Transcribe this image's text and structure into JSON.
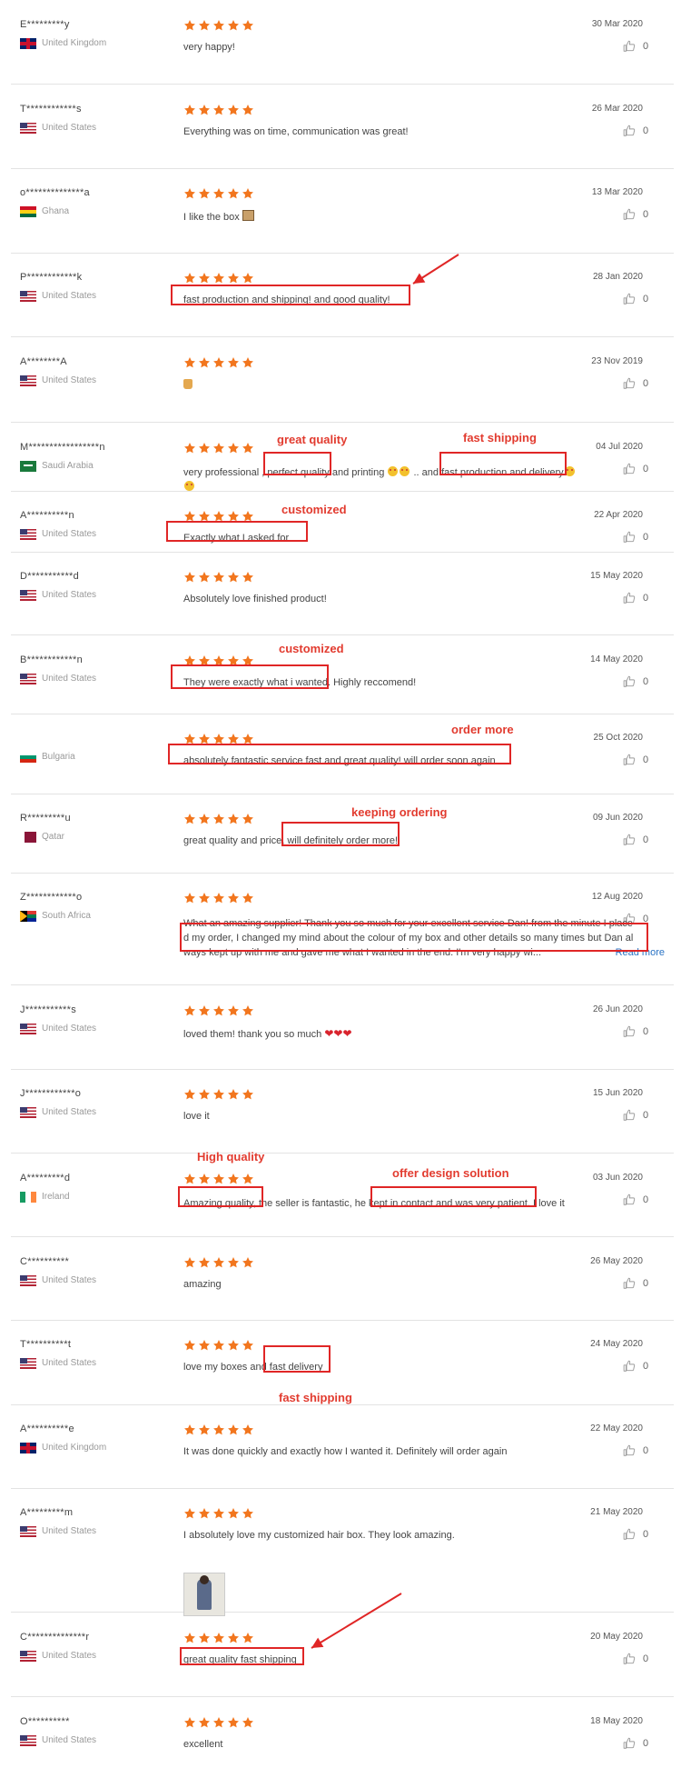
{
  "colors": {
    "star": "#f2761e",
    "annotation": "#e02626",
    "link": "#2a73c4"
  },
  "reviews": [
    {
      "name": "E*********y",
      "country": "United Kingdom",
      "flag": "uk",
      "date": "30 Mar 2020",
      "likes": "0",
      "text": "very happy!"
    },
    {
      "name": "T************s",
      "country": "United States",
      "flag": "us",
      "date": "26 Mar 2020",
      "likes": "0",
      "text": "Everything was on time, communication was great!"
    },
    {
      "name": "o**************a",
      "country": "Ghana",
      "flag": "gh",
      "date": "13 Mar 2020",
      "likes": "0",
      "text": "I like the box"
    },
    {
      "name": "P************k",
      "country": "United States",
      "flag": "us",
      "date": "28 Jan 2020",
      "likes": "0",
      "text": "fast production and shipping! and good quality!"
    },
    {
      "name": "A********A",
      "country": "United States",
      "flag": "us",
      "date": "23 Nov 2019",
      "likes": "0",
      "text": ""
    },
    {
      "name": "M*****************n",
      "country": "Saudi Arabia",
      "flag": "sa",
      "date": "04 Jul 2020",
      "likes": "0",
      "text_parts": [
        "very professional ,",
        "perfect quality",
        "and printing",
        ".. and",
        "fast production and delivery"
      ],
      "annotations": [
        "great quality",
        "fast shipping"
      ]
    },
    {
      "name": "A**********n",
      "country": "United States",
      "flag": "us",
      "date": "22 Apr 2020",
      "likes": "0",
      "text": "Exactly what I asked for",
      "annotation": "customized"
    },
    {
      "name": "D***********d",
      "country": "United States",
      "flag": "us",
      "date": "15 May 2020",
      "likes": "0",
      "text": "Absolutely love finished product!"
    },
    {
      "name": "B************n",
      "country": "United States",
      "flag": "us",
      "date": "14 May 2020",
      "likes": "0",
      "text": "They were exactly what i wanted. Highly reccomend!",
      "annotation": "customized"
    },
    {
      "name": "",
      "country": "Bulgaria",
      "flag": "bg",
      "date": "25 Oct 2020",
      "likes": "0",
      "text": "absolutely fantastic service fast and great quality! will order soon again",
      "annotation": "order more"
    },
    {
      "name": "R*********u",
      "country": "Qatar",
      "flag": "qa",
      "date": "09 Jun 2020",
      "likes": "0",
      "text": "great quality and price, will definitely order more!",
      "annotation": "keeping ordering"
    },
    {
      "name": "Z************o",
      "country": "South Africa",
      "flag": "za",
      "date": "12 Aug 2020",
      "likes": "0",
      "text_lines": [
        "What an amazing supplier! Thank you so much for your excellent service Dan! from the minute I place",
        "d my order, I changed my mind about the colour of my box and other details so many times but Dan al",
        "ways kept up with me and gave me what I wanted in the end. I'm very happy wi..."
      ],
      "read_more": "Read more"
    },
    {
      "name": "J***********s",
      "country": "United States",
      "flag": "us",
      "date": "26 Jun 2020",
      "likes": "0",
      "text": "loved them! thank you so much"
    },
    {
      "name": "J************o",
      "country": "United States",
      "flag": "us",
      "date": "15 Jun 2020",
      "likes": "0",
      "text": "love it"
    },
    {
      "name": "A*********d",
      "country": "Ireland",
      "flag": "ie",
      "date": "03 Jun 2020",
      "likes": "0",
      "text": "Amazing quality, the seller is fantastic, he kept in contact and was very patient. I love it",
      "annotations": [
        "High quality",
        "offer design solution"
      ]
    },
    {
      "name": "C**********",
      "country": "United States",
      "flag": "us",
      "date": "26 May 2020",
      "likes": "0",
      "text": "amazing"
    },
    {
      "name": "T**********t",
      "country": "United States",
      "flag": "us",
      "date": "24 May 2020",
      "likes": "0",
      "text": "love my boxes and fast delivery",
      "annotation": "fast shipping"
    },
    {
      "name": "A**********e",
      "country": "United Kingdom",
      "flag": "uk",
      "date": "22 May 2020",
      "likes": "0",
      "text": "It was done quickly and exactly how I wanted it. Definitely will order again"
    },
    {
      "name": "A*********m",
      "country": "United States",
      "flag": "us",
      "date": "21 May 2020",
      "likes": "0",
      "text": "I absolutely love my customized hair box. They look amazing."
    },
    {
      "name": "C**************r",
      "country": "United States",
      "flag": "us",
      "date": "20 May 2020",
      "likes": "0",
      "text": "great quality fast shipping"
    },
    {
      "name": "O**********",
      "country": "United States",
      "flag": "us",
      "date": "18 May 2020",
      "likes": "0",
      "text": "excellent"
    }
  ]
}
